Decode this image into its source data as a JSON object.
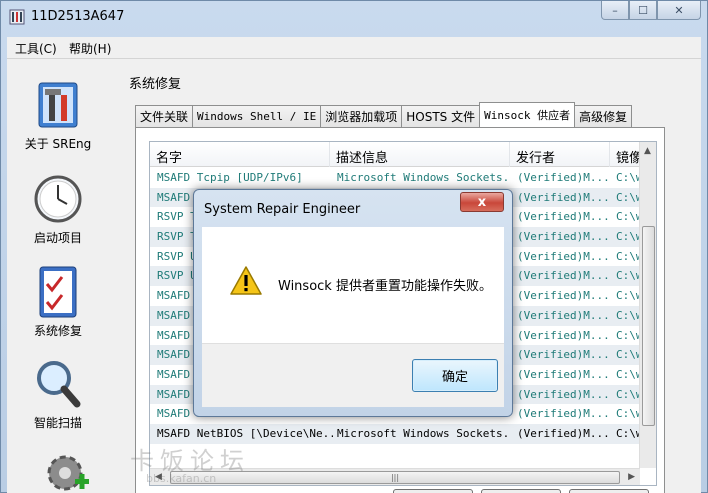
{
  "window": {
    "title": "11D2513A647",
    "controls": {
      "minimize": "–",
      "maximize": "☐",
      "close": "✕"
    }
  },
  "menu": [
    {
      "label": "工具(C)"
    },
    {
      "label": "帮助(H)"
    }
  ],
  "nav": [
    {
      "label": "关于 SREng",
      "icon": "toolbox-icon"
    },
    {
      "label": "启动项目",
      "icon": "clock-icon"
    },
    {
      "label": "系统修复",
      "icon": "checklist-icon"
    },
    {
      "label": "智能扫描",
      "icon": "magnifier-icon"
    }
  ],
  "group_title": "系统修复",
  "tabs": [
    {
      "label": "文件关联"
    },
    {
      "label": "Windows Shell / IE"
    },
    {
      "label": "浏览器加载项"
    },
    {
      "label": "HOSTS 文件"
    },
    {
      "label": "Winsock 供应者",
      "active": true
    },
    {
      "label": "高级修复"
    }
  ],
  "list": {
    "columns": [
      "名字",
      "描述信息",
      "发行者",
      "镜像"
    ],
    "rows": [
      {
        "name": "MSAFD Tcpip [UDP/IPv6]",
        "desc": "Microsoft Windows Sockets...",
        "pub": "(Verified)M...",
        "img": "C:\\w"
      },
      {
        "name": "MSAFD T",
        "desc": "",
        "pub": "(Verified)M...",
        "img": "C:\\w"
      },
      {
        "name": "RSVP TC",
        "desc": "",
        "pub": "(Verified)M...",
        "img": "C:\\w"
      },
      {
        "name": "RSVP TC",
        "desc": "",
        "pub": "(Verified)M...",
        "img": "C:\\w"
      },
      {
        "name": "RSVP UD",
        "desc": "",
        "pub": "(Verified)M...",
        "img": "C:\\w"
      },
      {
        "name": "RSVP UD",
        "desc": "",
        "pub": "(Verified)M...",
        "img": "C:\\w"
      },
      {
        "name": "MSAFD N",
        "desc": "",
        "pub": "(Verified)M...",
        "img": "C:\\w"
      },
      {
        "name": "MSAFD N",
        "desc": "",
        "pub": "(Verified)M...",
        "img": "C:\\w"
      },
      {
        "name": "MSAFD N",
        "desc": "",
        "pub": "(Verified)M...",
        "img": "C:\\w"
      },
      {
        "name": "MSAFD N",
        "desc": "",
        "pub": "(Verified)M...",
        "img": "C:\\w"
      },
      {
        "name": "MSAFD N",
        "desc": "",
        "pub": "(Verified)M...",
        "img": "C:\\w"
      },
      {
        "name": "MSAFD N",
        "desc": "",
        "pub": "(Verified)M...",
        "img": "C:\\w"
      },
      {
        "name": "MSAFD N",
        "desc": "",
        "pub": "(Verified)M...",
        "img": "C:\\w"
      },
      {
        "name": "MSAFD NetBIOS [\\Device\\Ne...",
        "desc": "Microsoft Windows Sockets...",
        "pub": "(Verified)M...",
        "img": "C:\\w"
      }
    ],
    "hscroll_grip": "|||"
  },
  "dialog": {
    "title": "System Repair Engineer",
    "close": "x",
    "message": "Winsock 提供者重置功能操作失败。",
    "ok": "确定"
  },
  "watermark": {
    "text": "卡饭论坛",
    "sub": "bbs.kafan.cn"
  },
  "colors": {
    "row_text": "#1f7b78",
    "close_red": "#c9473a"
  }
}
